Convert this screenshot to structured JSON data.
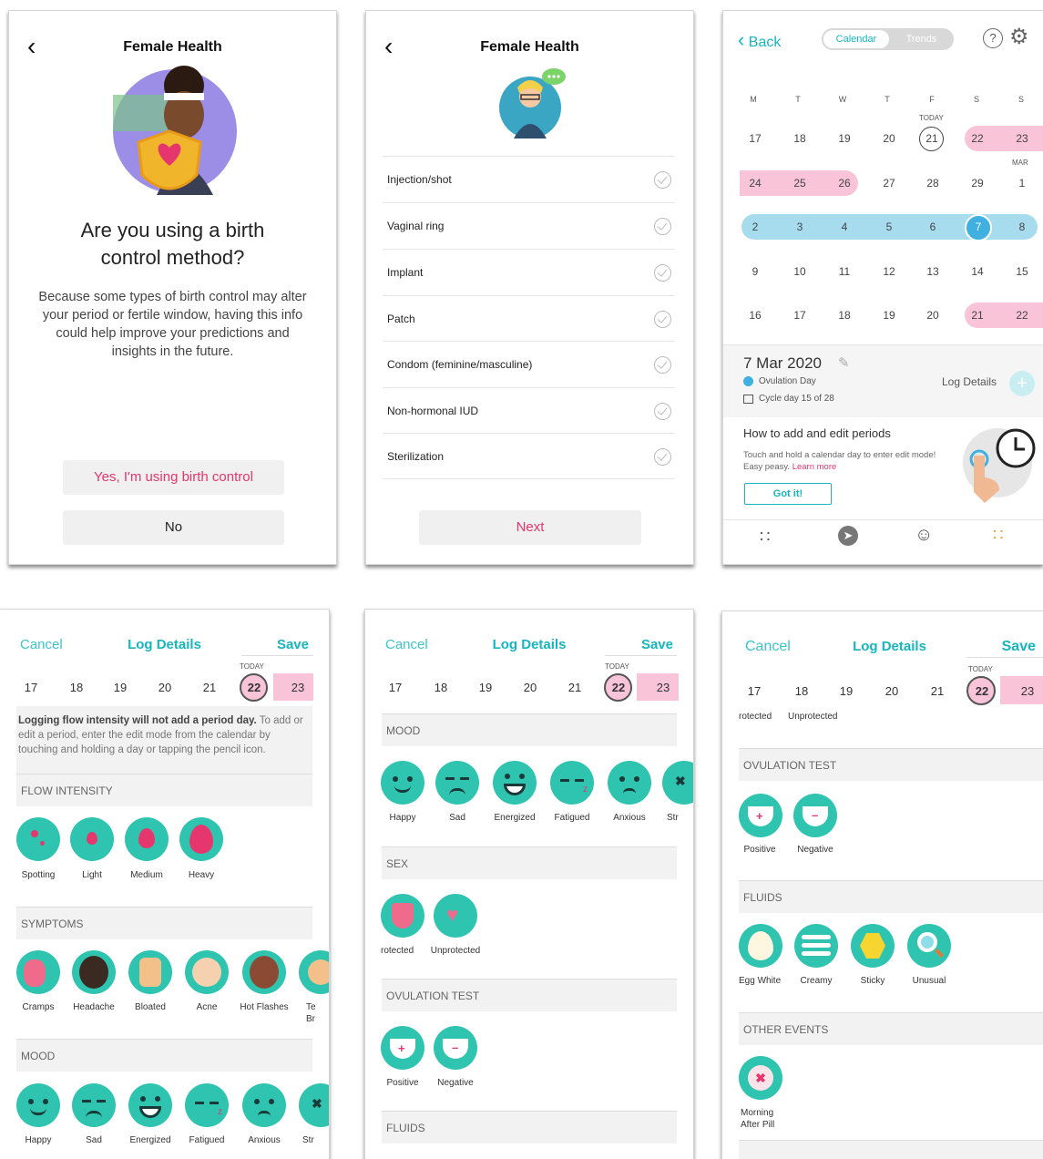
{
  "p1": {
    "title": "Female Health",
    "question": "Are you using a birth control method?",
    "body": "Because some types of birth control may alter your period or fertile window, having this info could help improve your predictions and insights in the future.",
    "yes_label": "Yes, I'm using birth control",
    "no_label": "No"
  },
  "p2": {
    "title": "Female Health",
    "options": [
      "Injection/shot",
      "Vaginal ring",
      "Implant",
      "Patch",
      "Condom (feminine/masculine)",
      "Non-hormonal IUD",
      "Sterilization"
    ],
    "next_label": "Next"
  },
  "p3": {
    "back_label": "Back",
    "seg_calendar": "Calendar",
    "seg_trends": "Trends",
    "weekdays": [
      "M",
      "T",
      "W",
      "T",
      "F",
      "S",
      "S"
    ],
    "today_label": "TODAY",
    "mar_label": "MAR",
    "rows": [
      [
        "17",
        "18",
        "19",
        "20",
        "21",
        "22",
        "23"
      ],
      [
        "24",
        "25",
        "26",
        "27",
        "28",
        "29",
        "1"
      ],
      [
        "2",
        "3",
        "4",
        "5",
        "6",
        "7",
        "8"
      ],
      [
        "9",
        "10",
        "11",
        "12",
        "13",
        "14",
        "15"
      ],
      [
        "16",
        "17",
        "18",
        "19",
        "20",
        "21",
        "22"
      ]
    ],
    "date_title": "7 Mar 2020",
    "ovulation": "Ovulation Day",
    "cycle": "Cycle day 15 of 28",
    "log_details": "Log Details",
    "tip_title": "How to add and edit periods",
    "tip_body": "Touch and hold a calendar day to enter edit mode! Easy peasy.",
    "learn_more": "Learn more",
    "got_it": "Got it!"
  },
  "log": {
    "cancel": "Cancel",
    "title": "Log Details",
    "save": "Save",
    "today": "TODAY",
    "days": [
      "17",
      "18",
      "19",
      "20",
      "21",
      "22",
      "23"
    ]
  },
  "p4": {
    "notice_bold": "Logging flow intensity will not add a period day.",
    "notice_rest": " To add or edit a period, enter the edit mode from the calendar by touching and holding a day or tapping the pencil icon.",
    "flow_header": "FLOW INTENSITY",
    "flow": [
      "Spotting",
      "Light",
      "Medium",
      "Heavy"
    ],
    "symptoms_header": "SYMPTOMS",
    "symptoms": [
      "Cramps",
      "Headache",
      "Bloated",
      "Acne",
      "Hot Flashes",
      "Te",
      "Br"
    ],
    "mood_header": "MOOD",
    "mood": [
      "Happy",
      "Sad",
      "Energized",
      "Fatigued",
      "Anxious",
      "Str"
    ]
  },
  "p5": {
    "mood_header": "MOOD",
    "mood": [
      "Happy",
      "Sad",
      "Energized",
      "Fatigued",
      "Anxious",
      "Str"
    ],
    "sex_header": "SEX",
    "sex": [
      "rotected",
      "Unprotected"
    ],
    "ov_header": "OVULATION TEST",
    "ov": [
      "Positive",
      "Negative"
    ],
    "fluids_header": "FLUIDS"
  },
  "p6": {
    "sex": [
      "rotected",
      "Unprotected"
    ],
    "ov_header": "OVULATION TEST",
    "ov": [
      "Positive",
      "Negative"
    ],
    "fluids_header": "FLUIDS",
    "fluids": [
      "Egg White",
      "Creamy",
      "Sticky",
      "Unusual"
    ],
    "other_header": "OTHER EVENTS",
    "other_line1": "Morning",
    "other_line2": "After Pill"
  },
  "colors": {
    "teal": "#17b5bd",
    "pink": "#e5366d",
    "icon": "#2ec4b0",
    "period": "#f9c4d8",
    "fertile": "#a7dcef"
  }
}
